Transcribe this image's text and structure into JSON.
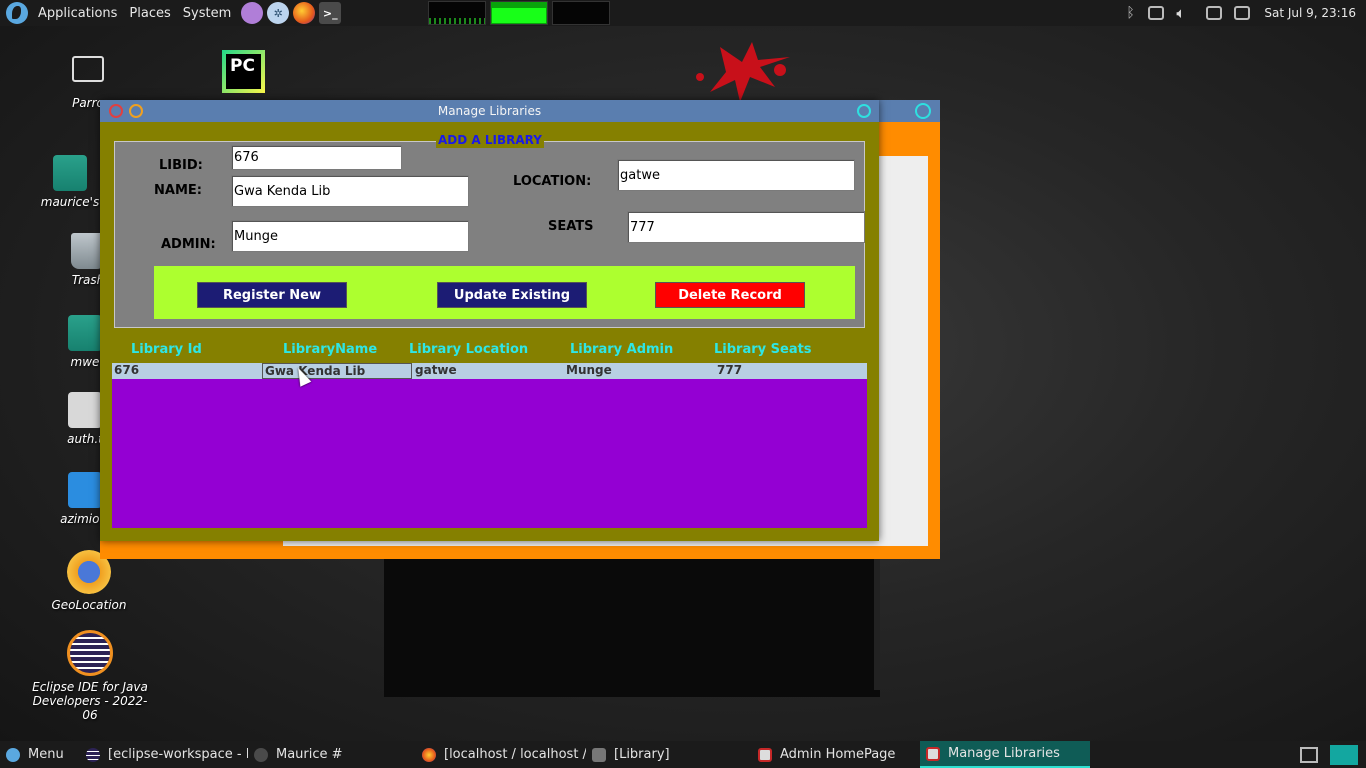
{
  "top_panel": {
    "menus": [
      "Applications",
      "Places",
      "System"
    ],
    "launchers": [
      "text-editor-icon",
      "maintenance-icon",
      "firefox-icon",
      "terminal-icon"
    ],
    "clock": "Sat Jul 9, 23:16"
  },
  "desktop": {
    "icons": [
      {
        "label": "Parro",
        "icon": "monitor-icon"
      },
      {
        "label": "maurice's",
        "icon": "home-folder-icon"
      },
      {
        "label": "Trash",
        "icon": "trash-icon"
      },
      {
        "label": "mwe",
        "icon": "folder-icon"
      },
      {
        "label": "auth.t",
        "icon": "text-file-icon"
      },
      {
        "label": "azimio.c",
        "icon": "document-icon"
      },
      {
        "label": "GeoLocation",
        "icon": "geolocation-icon"
      },
      {
        "label": "Eclipse IDE for Java Developers - 2022-06",
        "icon": "eclipse-icon"
      }
    ],
    "pycharm_label": "PC"
  },
  "window": {
    "title": "Manage Libraries",
    "form": {
      "legend": "ADD A LIBRARY",
      "libid_label": "LIBID:",
      "libid_value": "676",
      "name_label": "NAME:",
      "name_value": "Gwa Kenda Lib",
      "admin_label": "ADMIN:",
      "admin_value": "Munge",
      "location_label": "LOCATION:",
      "location_value": "gatwe",
      "seats_label": "SEATS",
      "seats_value": "777"
    },
    "buttons": {
      "register": "Register New",
      "update": "Update Existing",
      "delete": "Delete Record"
    },
    "table": {
      "columns": [
        "Library Id",
        "LibraryName",
        "Library Location",
        "Library Admin",
        "Library Seats"
      ],
      "rows": [
        [
          "676",
          "Gwa Kenda Lib",
          "gatwe",
          "Munge",
          "777"
        ]
      ]
    },
    "colors": {
      "frame": "#858000",
      "button_bar": "#adff2f",
      "table_bg": "#9400d3",
      "header_text": "#2ee6e6",
      "delete_button": "#ff0000"
    }
  },
  "taskbar": {
    "menu_label": "Menu",
    "tasks": [
      "[eclipse-workspace - Li...",
      "Maurice #",
      "[localhost / localhost / L...",
      "[Library]",
      "Admin HomePage",
      "Manage Libraries"
    ]
  }
}
